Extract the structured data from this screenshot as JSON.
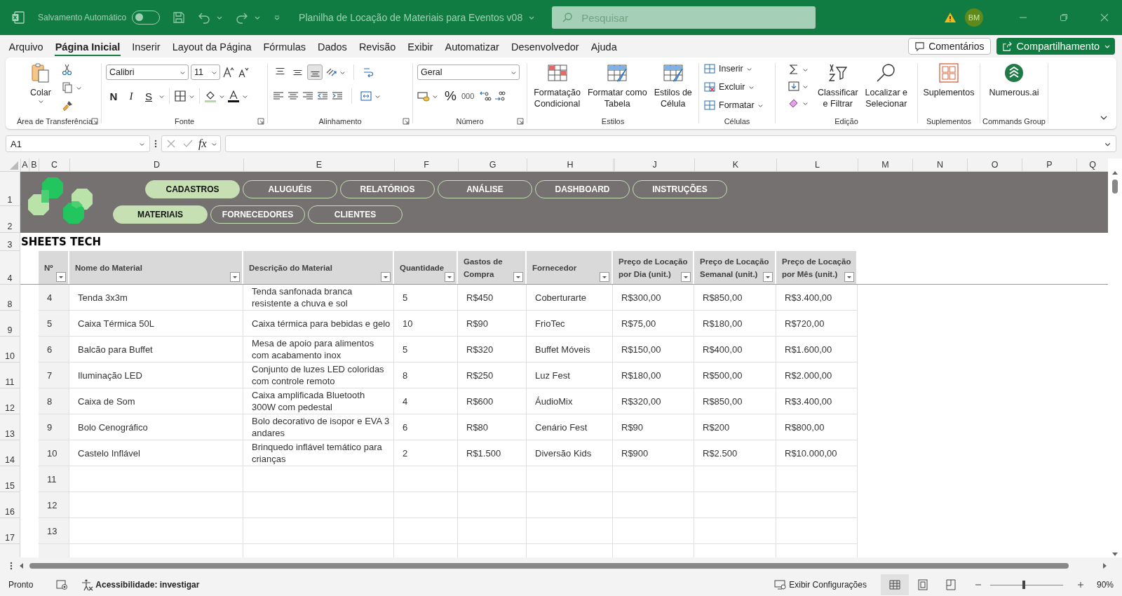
{
  "title_bar": {
    "autosave_label": "Salvamento Automático",
    "autosave_on": false,
    "document_title": "Planilha de Locação de Materiais para Eventos v08",
    "search_placeholder": "Pesquisar",
    "avatar_initials": "BM"
  },
  "menu_tabs": [
    {
      "label": "Arquivo",
      "selected": false
    },
    {
      "label": "Página Inicial",
      "selected": true
    },
    {
      "label": "Inserir",
      "selected": false
    },
    {
      "label": "Layout da Página",
      "selected": false
    },
    {
      "label": "Fórmulas",
      "selected": false
    },
    {
      "label": "Dados",
      "selected": false
    },
    {
      "label": "Revisão",
      "selected": false
    },
    {
      "label": "Exibir",
      "selected": false
    },
    {
      "label": "Automatizar",
      "selected": false
    },
    {
      "label": "Desenvolvedor",
      "selected": false
    },
    {
      "label": "Ajuda",
      "selected": false
    }
  ],
  "comments_button": "Comentários",
  "share_button": "Compartilhamento",
  "ribbon": {
    "clipboard": {
      "label": "Área de Transferência",
      "paste": "Colar"
    },
    "font": {
      "label": "Fonte",
      "font_name": "Calibri",
      "font_size": "11",
      "bold": "N",
      "italic": "I",
      "underline": "S"
    },
    "alignment": {
      "label": "Alinhamento",
      "vertical_align": [
        {
          "selected": false
        },
        {
          "selected": false
        },
        {
          "selected": true
        }
      ]
    },
    "number": {
      "label": "Número",
      "format": "Geral",
      "percent": "%",
      "thousands": "000"
    },
    "styles": {
      "label": "Estilos",
      "buttons": [
        "Formatação\nCondicional",
        "Formatar como\nTabela",
        "Estilos de\nCélula"
      ]
    },
    "cells": {
      "label": "Células",
      "items": [
        "Inserir",
        "Excluir",
        "Formatar"
      ]
    },
    "editing": {
      "label": "Edição",
      "buttons": [
        "Classificar\ne Filtrar",
        "Localizar e\nSelecionar"
      ]
    },
    "addins": {
      "label": "Suplementos",
      "button": "Suplementos"
    },
    "commands": {
      "label": "Commands Group",
      "button": "Numerous.ai"
    }
  },
  "formula_bar": {
    "name_box": "A1",
    "function_label": "fx"
  },
  "sheet": {
    "column_headers": [
      "A",
      "B",
      "C",
      "D",
      "E",
      "F",
      "G",
      "H",
      "J",
      "K",
      "L",
      "M",
      "N",
      "O",
      "P",
      "Q"
    ],
    "row_numbers": [
      "1",
      "2",
      "3",
      "4",
      "8",
      "9",
      "10",
      "11",
      "12",
      "13",
      "14",
      "15",
      "16",
      "17"
    ],
    "nav_top": [
      {
        "label": "CADASTROS",
        "selected": true
      },
      {
        "label": "ALUGUÉIS",
        "selected": false
      },
      {
        "label": "RELATÓRIOS",
        "selected": false
      },
      {
        "label": "ANÁLISE",
        "selected": false
      },
      {
        "label": "DASHBOARD",
        "selected": false
      },
      {
        "label": "INSTRUÇÕES",
        "selected": false
      }
    ],
    "nav_sub": [
      {
        "label": "MATERIAIS",
        "selected": true
      },
      {
        "label": "FORNECEDORES",
        "selected": false
      },
      {
        "label": "CLIENTES",
        "selected": false
      }
    ],
    "brand": "SHEETS TECH",
    "table": {
      "columns": [
        "Nº",
        "Nome do Material",
        "Descrição do Material",
        "Quantidade",
        "Gastos de Compra",
        "Fornecedor",
        "Preço de Locação por Dia (unit.)",
        "Preço de Locação Semanal (unit.)",
        "Preço de Locação por Mês (unit.)"
      ],
      "rows": [
        [
          "4",
          "Tenda 3x3m",
          "Tenda sanfonada branca resistente a chuva e sol",
          "5",
          "R$450",
          "Coberturarte",
          "R$300,00",
          "R$850,00",
          "R$3.400,00"
        ],
        [
          "5",
          "Caixa Térmica 50L",
          "Caixa térmica para bebidas e gelo",
          "10",
          "R$90",
          "FrioTec",
          "R$75,00",
          "R$180,00",
          "R$720,00"
        ],
        [
          "6",
          "Balcão para Buffet",
          "Mesa de apoio para alimentos com acabamento inox",
          "5",
          "R$320",
          "Buffet Móveis",
          "R$150,00",
          "R$400,00",
          "R$1.600,00"
        ],
        [
          "7",
          "Iluminação LED",
          "Conjunto de luzes LED coloridas com controle remoto",
          "8",
          "R$250",
          "Luz Fest",
          "R$180,00",
          "R$500,00",
          "R$2.000,00"
        ],
        [
          "8",
          "Caixa de Som",
          "Caixa amplificada Bluetooth 300W com pedestal",
          "4",
          "R$600",
          "ÁudioMix",
          "R$320,00",
          "R$850,00",
          "R$3.400,00"
        ],
        [
          "9",
          "Bolo Cenográfico",
          "Bolo decorativo de isopor e EVA 3 andares",
          "6",
          "R$80",
          "Cenário Fest",
          "R$90",
          "R$200",
          "R$800,00"
        ],
        [
          "10",
          "Castelo Inflável",
          "Brinquedo inflável temático para crianças",
          "2",
          "R$1.500",
          "Diversão Kids",
          "R$900",
          "R$2.500",
          "R$10.000,00"
        ],
        [
          "11"
        ],
        [
          "12"
        ],
        [
          "13"
        ]
      ]
    }
  },
  "status_bar": {
    "ready": "Pronto",
    "accessibility": "Acessibilidade: investigar",
    "display_settings": "Exibir Configurações",
    "views": [
      {
        "kind": "normal",
        "selected": true
      },
      {
        "kind": "page_layout",
        "selected": false
      },
      {
        "kind": "page_break",
        "selected": false
      }
    ],
    "zoom": {
      "level": 0.46,
      "label": "90%"
    }
  }
}
